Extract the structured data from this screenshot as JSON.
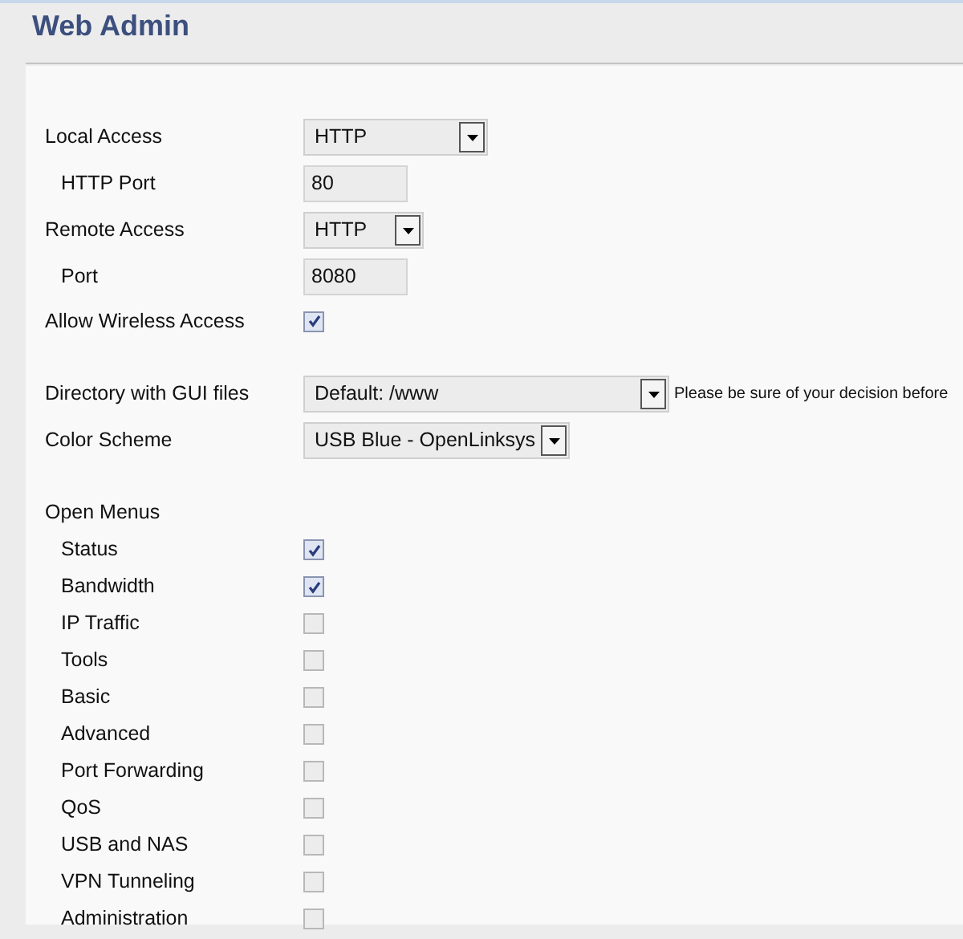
{
  "page": {
    "title": "Web Admin"
  },
  "sections": [
    {
      "rows": [
        {
          "label": "Local Access",
          "kind": "select",
          "value": "HTTP",
          "children": [
            {
              "label": "HTTP Port",
              "kind": "input",
              "value": "80"
            }
          ]
        },
        {
          "label": "Remote Access",
          "kind": "select",
          "value": "HTTP",
          "children": [
            {
              "label": "Port",
              "kind": "input",
              "value": "8080"
            }
          ]
        },
        {
          "label": "Allow Wireless Access",
          "kind": "checkbox",
          "checked": true
        }
      ]
    },
    {
      "rows": [
        {
          "label": "Directory with GUI files",
          "kind": "select",
          "value": "Default: /www",
          "note": "Please be sure of your decision before"
        },
        {
          "label": "Color Scheme",
          "kind": "select",
          "value": "USB Blue - OpenLinksys"
        }
      ]
    },
    {
      "rows": [
        {
          "label": "Open Menus",
          "kind": "heading",
          "children": [
            {
              "label": "Status",
              "kind": "checkbox",
              "checked": true
            },
            {
              "label": "Bandwidth",
              "kind": "checkbox",
              "checked": true
            },
            {
              "label": "IP Traffic",
              "kind": "checkbox",
              "checked": false
            },
            {
              "label": "Tools",
              "kind": "checkbox",
              "checked": false
            },
            {
              "label": "Basic",
              "kind": "checkbox",
              "checked": false
            },
            {
              "label": "Advanced",
              "kind": "checkbox",
              "checked": false
            },
            {
              "label": "Port Forwarding",
              "kind": "checkbox",
              "checked": false
            },
            {
              "label": "QoS",
              "kind": "checkbox",
              "checked": false
            },
            {
              "label": "USB and NAS",
              "kind": "checkbox",
              "checked": false
            },
            {
              "label": "VPN Tunneling",
              "kind": "checkbox",
              "checked": false
            },
            {
              "label": "Administration",
              "kind": "checkbox",
              "checked": false
            }
          ]
        }
      ]
    }
  ]
}
